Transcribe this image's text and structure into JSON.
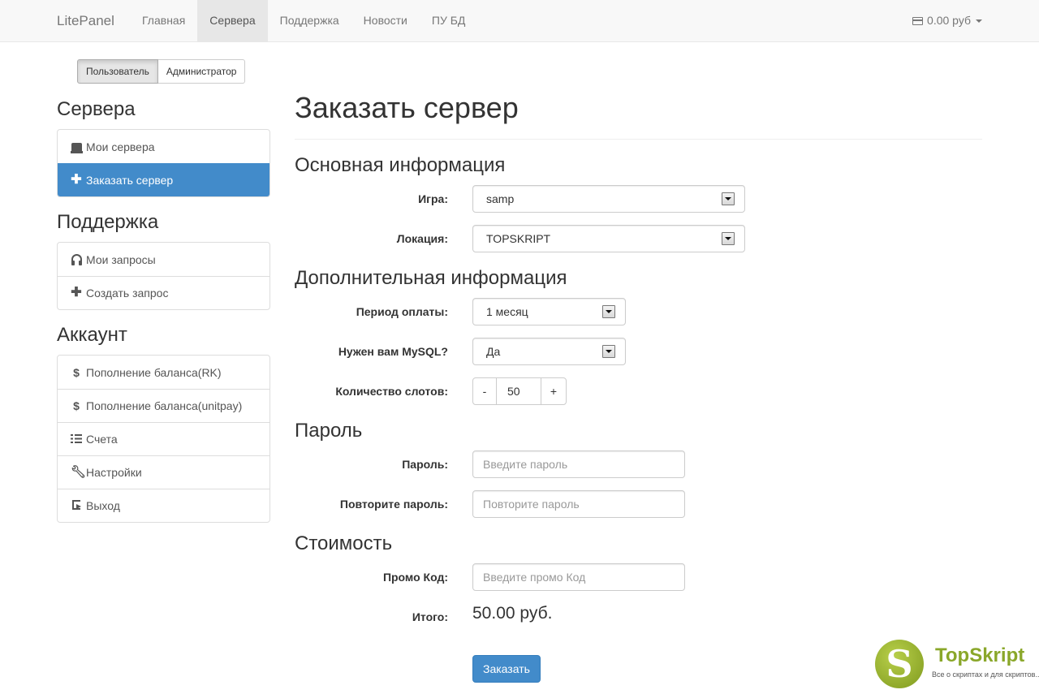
{
  "navbar": {
    "brand": "LitePanel",
    "items": [
      "Главная",
      "Сервера",
      "Поддержка",
      "Новости",
      "ПУ БД"
    ],
    "active": "Сервера",
    "balance": "0.00 руб"
  },
  "role_toggle": {
    "user": "Пользователь",
    "admin": "Администратор"
  },
  "sidebar": {
    "servers_heading": "Сервера",
    "servers": [
      {
        "label": "Мои сервера",
        "icon": "hdd-icon"
      },
      {
        "label": "Заказать сервер",
        "icon": "plus-icon",
        "active": true
      }
    ],
    "support_heading": "Поддержка",
    "support": [
      {
        "label": "Мои запросы",
        "icon": "headphones-icon"
      },
      {
        "label": "Создать запрос",
        "icon": "plus-icon"
      }
    ],
    "account_heading": "Аккаунт",
    "account": [
      {
        "label": "Пополнение баланса(RK)",
        "icon": "dollar-icon"
      },
      {
        "label": "Пополнение баланса(unitpay)",
        "icon": "dollar-icon"
      },
      {
        "label": "Счета",
        "icon": "list-icon"
      },
      {
        "label": "Настройки",
        "icon": "wrench-icon"
      },
      {
        "label": "Выход",
        "icon": "logout-icon"
      }
    ]
  },
  "main": {
    "title": "Заказать сервер",
    "basic": {
      "heading": "Основная информация",
      "game_label": "Игра:",
      "game_value": "samp",
      "location_label": "Локация:",
      "location_value": "TOPSKRIPT"
    },
    "extra": {
      "heading": "Дополнительная информация",
      "period_label": "Период оплаты:",
      "period_value": "1 месяц",
      "mysql_label": "Нужен вам MySQL?",
      "mysql_value": "Да",
      "slots_label": "Количество слотов:",
      "slots_minus": "-",
      "slots_value": "50",
      "slots_plus": "+"
    },
    "password": {
      "heading": "Пароль",
      "password_label": "Пароль:",
      "password_placeholder": "Введите пароль",
      "repeat_label": "Повторите пароль:",
      "repeat_placeholder": "Повторите пароль"
    },
    "cost": {
      "heading": "Стоимость",
      "promo_label": "Промо Код:",
      "promo_placeholder": "Введите промо Код",
      "total_label": "Итого:",
      "total_value": "50.00 руб."
    },
    "order_button": "Заказать"
  },
  "watermark": {
    "letter": "S",
    "title": "TopSkript",
    "subtitle": "Все о скриптах и для скриптов..."
  }
}
